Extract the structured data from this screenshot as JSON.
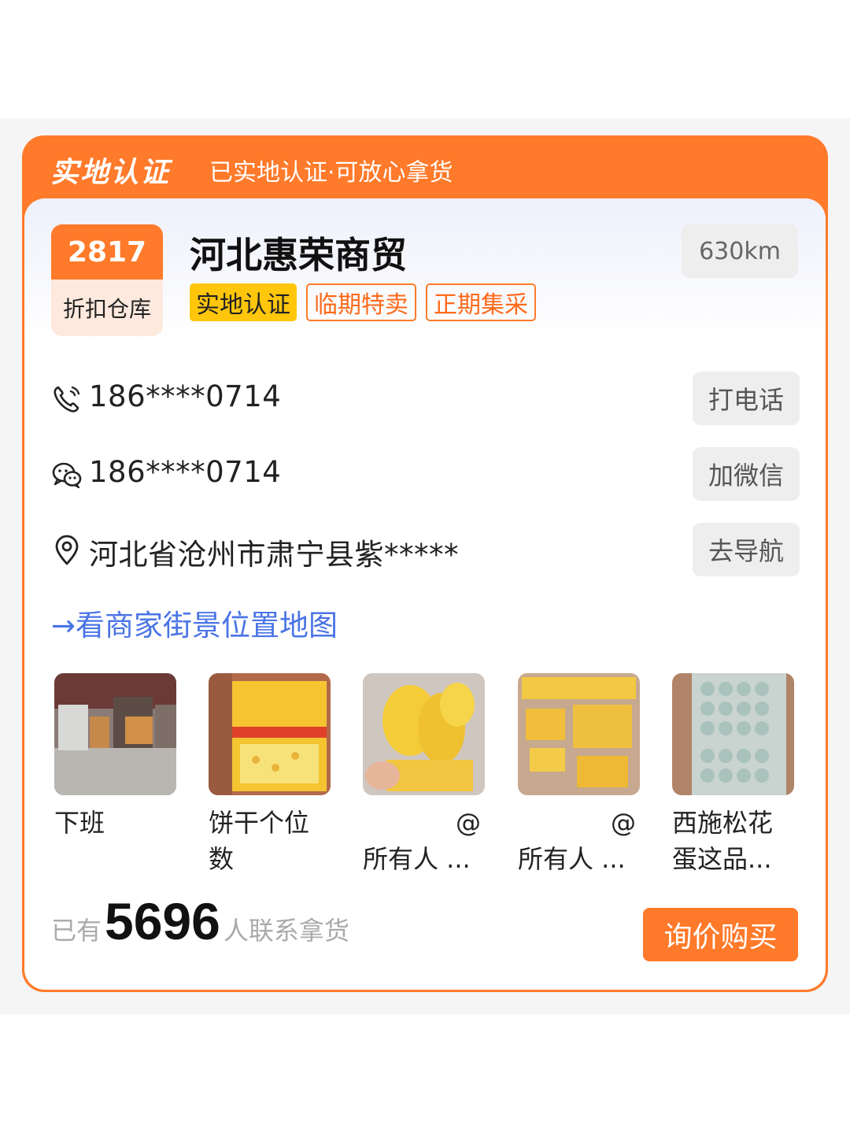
{
  "header": {
    "title": "实地认证",
    "subtitle": "已实地认证·可放心拿货"
  },
  "badge": {
    "number": "2817",
    "label": "折扣仓库"
  },
  "company": {
    "name": "河北惠荣商贸",
    "distance": "630km",
    "tags": [
      "实地认证",
      "临期特卖",
      "正期集采"
    ]
  },
  "contact": {
    "phone": {
      "text": "186****0714",
      "button": "打电话",
      "icon": "phone-icon"
    },
    "wechat": {
      "text": "186****0714",
      "button": "加微信",
      "icon": "wechat-icon"
    },
    "address": {
      "text": "河北省沧州市肃宁县紫*****",
      "button": "去导航",
      "icon": "location-pin-icon"
    }
  },
  "map_link": "→看商家街景位置地图",
  "photos": [
    {
      "caption_1": "下班",
      "caption_2": ""
    },
    {
      "caption_1": "饼干个位",
      "caption_2": "数"
    },
    {
      "caption_1": "@",
      "caption_2": "所有人 ..."
    },
    {
      "caption_1": "@",
      "caption_2": "所有人 ..."
    },
    {
      "caption_1": "西施松花",
      "caption_2": "蛋这品..."
    }
  ],
  "stats": {
    "prefix": "已有",
    "count": "5696",
    "suffix": "人联系拿货"
  },
  "buy_button": "询价购买",
  "colors": {
    "accent": "#ff7a2a",
    "tag_yellow": "#ffc60b",
    "link_blue": "#4a74e6"
  }
}
